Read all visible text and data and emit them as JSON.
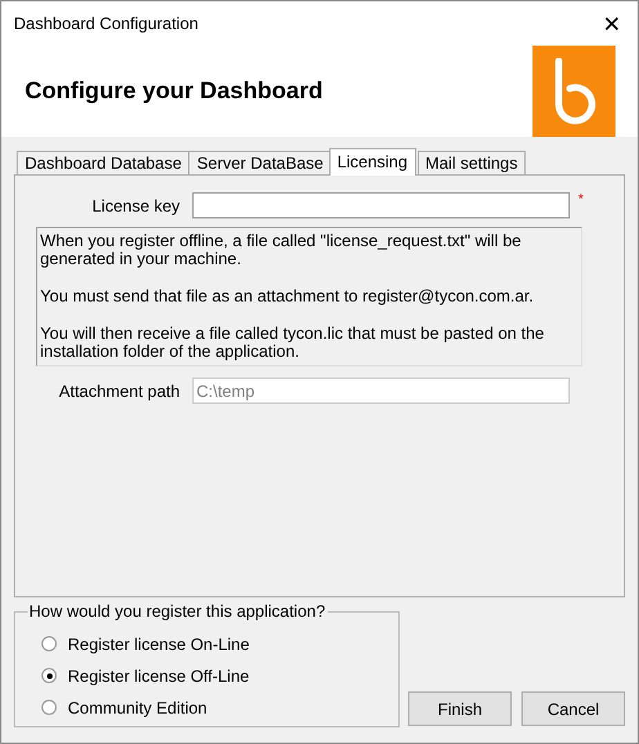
{
  "window": {
    "title": "Dashboard Configuration",
    "close": "✕"
  },
  "header": {
    "heading": "Configure your Dashboard"
  },
  "tabs": [
    {
      "label": "Dashboard Database",
      "selected": false
    },
    {
      "label": "Server DataBase",
      "selected": false
    },
    {
      "label": "Licensing",
      "selected": true
    },
    {
      "label": "Mail settings",
      "selected": false
    }
  ],
  "license_key": {
    "label": "License key",
    "required_mark": "*"
  },
  "info": [
    "When you register offline, a file called \"license_request.txt\" will be generated in your machine.",
    "You must send that file as an attachment to register@tycon.com.ar.",
    "You will then receive a file called tycon.lic that must be pasted on the installation folder of the application."
  ],
  "attachment_path": {
    "label": "Attachment path",
    "value": "C:\\temp",
    "disabled": true
  },
  "register_group": {
    "title": "How would you register this application?",
    "options": [
      {
        "label": "Register license On-Line",
        "selected": false
      },
      {
        "label": "Register license Off-Line",
        "selected": true
      },
      {
        "label": "Community Edition",
        "selected": false
      }
    ]
  },
  "buttons": [
    "Finish",
    "Cancel"
  ]
}
